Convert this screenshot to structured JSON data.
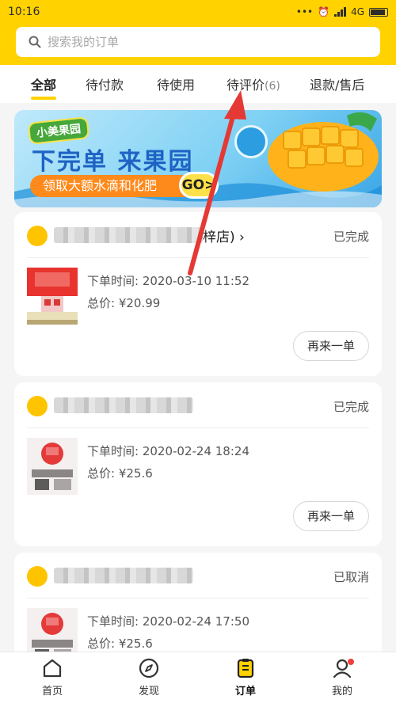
{
  "status_bar": {
    "time": "10:16",
    "network": "4G"
  },
  "search": {
    "placeholder": "搜索我的订单"
  },
  "tabs": [
    {
      "label": "全部",
      "active": true
    },
    {
      "label": "待付款"
    },
    {
      "label": "待使用"
    },
    {
      "label": "待评价",
      "count": "(6)"
    },
    {
      "label": "退款/售后"
    }
  ],
  "banner": {
    "logo": "小美果园",
    "title": "下完单 来果园",
    "subtitle": "领取大额水滴和化肥",
    "cta": "GO>"
  },
  "orders": [
    {
      "store_suffix": "梓店)",
      "store_chevron": "›",
      "status": "已完成",
      "time_label": "下单时间: 2020-03-10 11:52",
      "price_label": "总价: ¥20.99",
      "action": "再来一单"
    },
    {
      "store_suffix": "",
      "status": "已完成",
      "time_label": "下单时间: 2020-02-24 18:24",
      "price_label": "总价: ¥25.6",
      "action": "再来一单"
    },
    {
      "store_suffix": "",
      "status": "已取消",
      "time_label": "下单时间: 2020-02-24 17:50",
      "price_label": "总价: ¥25.6"
    }
  ],
  "bottom_nav": [
    {
      "label": "首页"
    },
    {
      "label": "发现"
    },
    {
      "label": "订单",
      "active": true
    },
    {
      "label": "我的"
    }
  ],
  "colors": {
    "brand_yellow": "#ffd200",
    "annotation_red": "#e53935"
  }
}
